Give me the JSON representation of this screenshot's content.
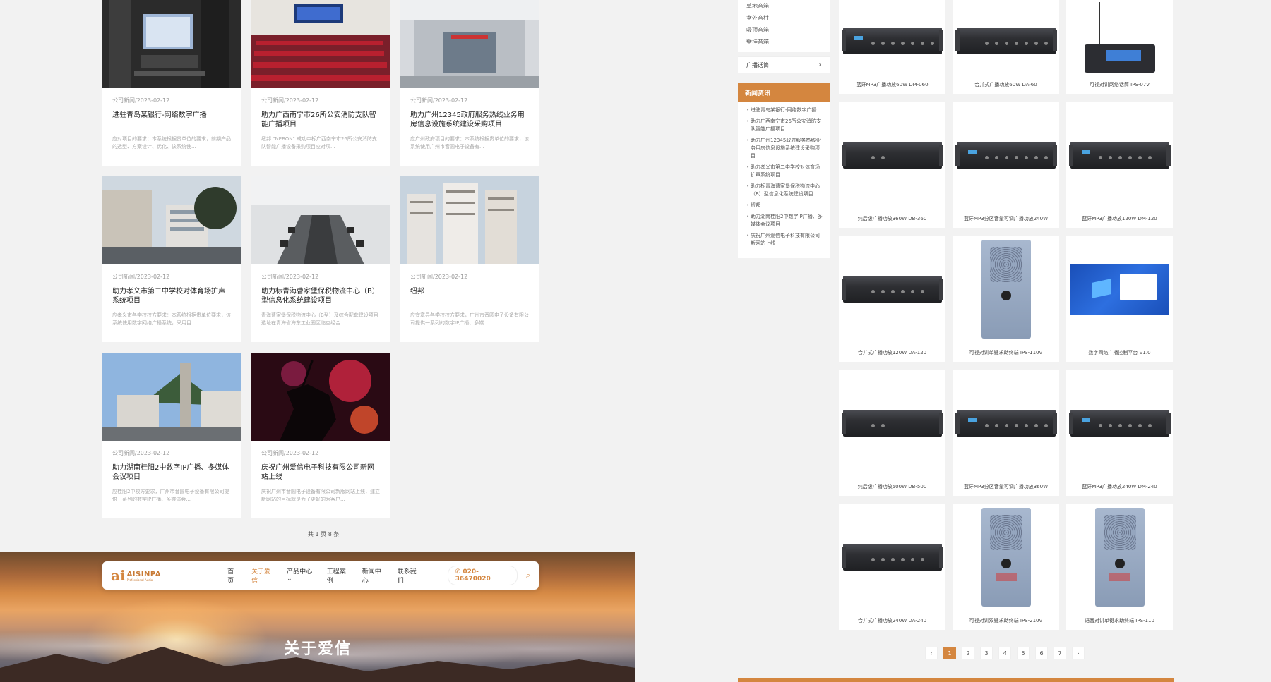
{
  "news": [
    {
      "meta": "公司新闻/2023-02-12",
      "title": "进驻青岛某银行-网络数字广播",
      "desc": "应对项目的要求：本系统根据贵单位的要求，前期产品的选型、方案设计、优化、该系统使..."
    },
    {
      "meta": "公司新闻/2023-02-12",
      "title": "助力广西南宁市26所公安消防支队智能广播项目",
      "desc": "纽邦 \"NEBON\" 成功中标广西南宁市26所公安消防支队智能广播设备采购项目应对项..."
    },
    {
      "meta": "公司新闻/2023-02-12",
      "title": "助力广州12345政府服务热线业务用房信息设施系统建设采购项目",
      "desc": "应广州政府项目的要求：本系统根据贵单位的要求，该系统使用广州市音圆电子设备有..."
    },
    {
      "meta": "公司新闻/2023-02-12",
      "title": "助力孝义市第二中学校对体育场扩声系统项目",
      "desc": "应孝义市各学校校方要求：本系统根据贵单位要求，该系统使用数字网络广播系统，采用目..."
    },
    {
      "meta": "公司新闻/2023-02-12",
      "title": "助力标青海曹家堡保税物流中心（B）型信息化系统建设项目",
      "desc": "青海曹家堡保税物流中心（B型）及综合配套建设项目选址在青海省海东工业园区临空经合..."
    },
    {
      "meta": "公司新闻/2023-02-12",
      "title": "纽邦",
      "desc": "应宜章县各学校校方要求，广州市音圆电子设备有限公司提供一系列的数字IP广播、多媒..."
    },
    {
      "meta": "公司新闻/2023-02-12",
      "title": "助力湖南桂阳2中数字IP广播、多媒体会议项目",
      "desc": "应桂阳2中校方要求，广州市音圆电子设备有限公司提供一系列的数字IP广播、多媒体会..."
    },
    {
      "meta": "公司新闻/2023-02-12",
      "title": "庆祝广州爱信电子科技有限公司新网站上线",
      "desc": "庆祝广州市音圆电子设备有限公司新版网站上线，建立新网站的目标就是为了更好的为客户..."
    }
  ],
  "page_total": "共 1 页 8 条",
  "nav": {
    "logo_mark": "ai",
    "logo_brand": "AISINPA",
    "logo_sub": "Professional Audio",
    "links": [
      "首页",
      "关于爱信",
      "产品中心",
      "工程案例",
      "新闻中心",
      "联系我们"
    ],
    "active_index": 1,
    "phone": "020-36470020"
  },
  "banner_title": "关于爱信",
  "sidebar": {
    "categories": [
      "草地音箱",
      "室外音柱",
      "吸顶音箱",
      "壁挂音箱"
    ],
    "category_row": "广播话筒",
    "news_head": "新闻资讯",
    "news_links": [
      "进驻青岛某银行-网络数字广播",
      "助力广西南宁市26所公安消防支队智能广播项目",
      "助力广州12345政府服务热线业务用房信息设施系统建设采购项目",
      "助力孝义市第二中学校对体育场扩声系统项目",
      "助力标青海曹家堡保税物流中心（B）型信息化系统建设项目",
      "纽邦",
      "助力湖南桂阳2中数字IP广播、多媒体会议项目",
      "庆祝广州爱信电子科技有限公司新网站上线"
    ]
  },
  "products": [
    {
      "name": "蓝牙MP3广播功放60W DM-060",
      "kind": "amp"
    },
    {
      "name": "合并式广播功放60W DA-60",
      "kind": "amp"
    },
    {
      "name": "可视对讲网络话筒 IPS-07V",
      "kind": "mic"
    },
    {
      "name": "纯后级广播功放360W DB-360",
      "kind": "amp"
    },
    {
      "name": "蓝牙MP3分区音量可调广播功放240W",
      "kind": "amp"
    },
    {
      "name": "蓝牙MP3广播功放120W DM-120",
      "kind": "amp"
    },
    {
      "name": "合并式广播功放120W DA-120",
      "kind": "amp"
    },
    {
      "name": "可视对讲单键求助终端 IPS-110V",
      "kind": "terminal"
    },
    {
      "name": "数字网络广播控制平台 V1.0",
      "kind": "screen"
    },
    {
      "name": "纯后级广播功放500W DB-500",
      "kind": "amp"
    },
    {
      "name": "蓝牙MP3分区音量可调广播功放360W",
      "kind": "amp"
    },
    {
      "name": "蓝牙MP3广播功放240W DM-240",
      "kind": "amp"
    },
    {
      "name": "合并式广播功放240W DA-240",
      "kind": "amp"
    },
    {
      "name": "可视对讲双键求助终端 IPS-210V",
      "kind": "terminal"
    },
    {
      "name": "语音对讲单键求助终端 IPS-110",
      "kind": "terminal"
    }
  ],
  "pagination": [
    "‹",
    "1",
    "2",
    "3",
    "4",
    "5",
    "6",
    "7",
    "›"
  ],
  "pagination_active": 1,
  "colors": {
    "accent": "#d4863f"
  }
}
